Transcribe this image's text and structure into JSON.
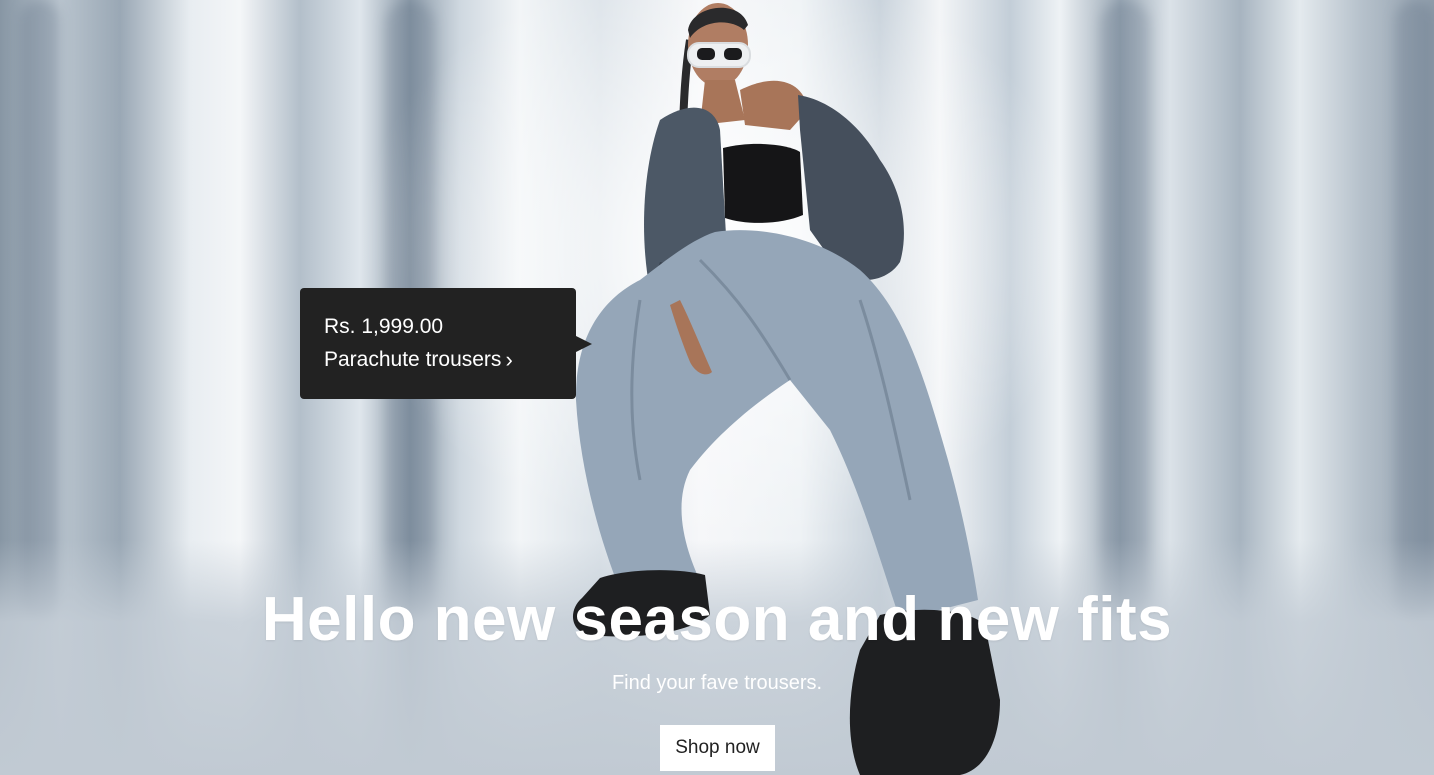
{
  "hero": {
    "headline": "Hello new season and new fits",
    "subheadline": "Find your fave trousers.",
    "cta_label": "Shop now"
  },
  "product_tag": {
    "price": "Rs. 1,999.00",
    "name": "Parachute trousers",
    "chevron_icon": "chevron-right-icon"
  },
  "colors": {
    "tooltip_bg": "#222222",
    "cta_bg": "#ffffff",
    "text_light": "#ffffff"
  }
}
